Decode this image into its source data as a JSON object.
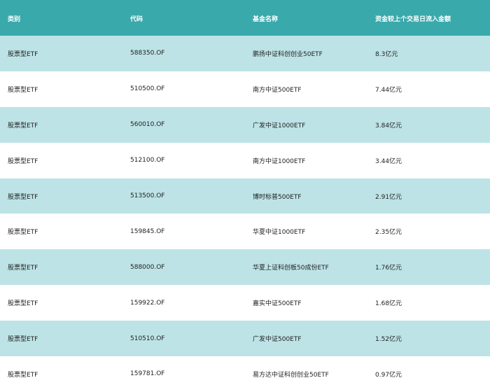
{
  "table": {
    "headers": [
      "类别",
      "代码",
      "基金名称",
      "资金较上个交易日流入金额"
    ],
    "rows": [
      [
        "股票型ETF",
        "588350.OF",
        "鹏扬中证科创创业50ETF",
        "8.3亿元"
      ],
      [
        "股票型ETF",
        "510500.OF",
        "南方中证500ETF",
        "7.44亿元"
      ],
      [
        "股票型ETF",
        "560010.OF",
        "广发中证1000ETF",
        "3.84亿元"
      ],
      [
        "股票型ETF",
        "512100.OF",
        "南方中证1000ETF",
        "3.44亿元"
      ],
      [
        "股票型ETF",
        "513500.OF",
        "博时标普500ETF",
        "2.91亿元"
      ],
      [
        "股票型ETF",
        "159845.OF",
        "华夏中证1000ETF",
        "2.35亿元"
      ],
      [
        "股票型ETF",
        "588000.OF",
        "华夏上证科创板50成份ETF",
        "1.76亿元"
      ],
      [
        "股票型ETF",
        "159922.OF",
        "嘉实中证500ETF",
        "1.68亿元"
      ],
      [
        "股票型ETF",
        "510510.OF",
        "广发中证500ETF",
        "1.52亿元"
      ],
      [
        "股票型ETF",
        "159781.OF",
        "易方达中证科创创业50ETF",
        "0.97亿元"
      ]
    ]
  },
  "colors": {
    "header_bg": "#3aa9ac",
    "row_alt_bg": "#bde3e6",
    "row_bg": "#ffffff"
  }
}
